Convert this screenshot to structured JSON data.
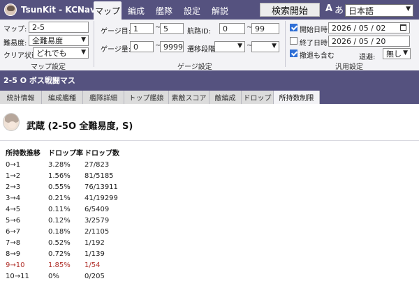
{
  "app": {
    "title": "TsunKit - KCNav"
  },
  "nav_tabs": [
    {
      "label": "マップ",
      "active": true
    },
    {
      "label": "編成",
      "active": false
    },
    {
      "label": "艦隊",
      "active": false
    },
    {
      "label": "設定",
      "active": false
    },
    {
      "label": "解説",
      "active": false
    }
  ],
  "header": {
    "start_button": "検索開始",
    "lang_glyph_a": "A",
    "lang_glyph_b": "あ",
    "language": "日本語"
  },
  "map_settings": {
    "map_label": "マップ:",
    "map_value": "2-5",
    "difficulty_label": "難易度:",
    "difficulty_value": "全難易度",
    "clear_label": "クリア状態:",
    "clear_value": "どれでも",
    "caption": "マップ設定"
  },
  "gauge_settings": {
    "gauge_num_label": "ゲージ目:",
    "gauge_num_from": "1",
    "gauge_num_to": "5",
    "gauge_amount_label": "ゲージ量:",
    "gauge_amount_from": "0",
    "gauge_amount_to": "99999",
    "route_id_label": "航路ID:",
    "route_id_from": "0",
    "route_id_to": "99",
    "transition_label": "遷移段階:",
    "transition_from": "",
    "transition_to": "",
    "range_sep": "~",
    "caption": "ゲージ設定"
  },
  "general_settings": {
    "start_date_label": "開始日時:",
    "start_date_checked": true,
    "start_date_value": "2026 / 05 / 02",
    "end_date_label": "終了日時:",
    "end_date_checked": false,
    "end_date_value": "2026 / 05 / 20",
    "include_retreat_label": "撤退も含む",
    "include_retreat_checked": true,
    "retreat_label": "退避:",
    "retreat_value": "無し",
    "caption": "汎用設定"
  },
  "section": {
    "title": "2-5 O ボス戦闘マス"
  },
  "sub_tabs": [
    {
      "label": "統計情報",
      "active": false
    },
    {
      "label": "編成艦種",
      "active": false
    },
    {
      "label": "艦隊詳細",
      "active": false
    },
    {
      "label": "トップ艦娘",
      "active": false
    },
    {
      "label": "素敵スコア",
      "active": false
    },
    {
      "label": "敵編成",
      "active": false
    },
    {
      "label": "ドロップ",
      "active": false
    },
    {
      "label": "所持数制限",
      "active": true
    }
  ],
  "ship": {
    "title": "武蔵 (2-5O 全難易度, S)"
  },
  "table": {
    "headers": [
      "所持数推移",
      "ドロップ率",
      "ドロップ数"
    ],
    "rows": [
      {
        "step": "0→1",
        "rate": "3.28%",
        "count": "27/823",
        "highlight": false
      },
      {
        "step": "1→2",
        "rate": "1.56%",
        "count": "81/5185",
        "highlight": false
      },
      {
        "step": "2→3",
        "rate": "0.55%",
        "count": "76/13911",
        "highlight": false
      },
      {
        "step": "3→4",
        "rate": "0.21%",
        "count": "41/19299",
        "highlight": false
      },
      {
        "step": "4→5",
        "rate": "0.11%",
        "count": "6/5409",
        "highlight": false
      },
      {
        "step": "5→6",
        "rate": "0.12%",
        "count": "3/2579",
        "highlight": false
      },
      {
        "step": "6→7",
        "rate": "0.18%",
        "count": "2/1105",
        "highlight": false
      },
      {
        "step": "7→8",
        "rate": "0.52%",
        "count": "1/192",
        "highlight": false
      },
      {
        "step": "8→9",
        "rate": "0.72%",
        "count": "1/139",
        "highlight": false
      },
      {
        "step": "9→10",
        "rate": "1.85%",
        "count": "1/54",
        "highlight": true
      },
      {
        "step": "10→11",
        "rate": "0%",
        "count": "0/205",
        "highlight": false
      }
    ]
  },
  "colors": {
    "accent": "#55527f",
    "highlight_row": "#b0302a",
    "panel_bg": "#f3f3f6"
  }
}
